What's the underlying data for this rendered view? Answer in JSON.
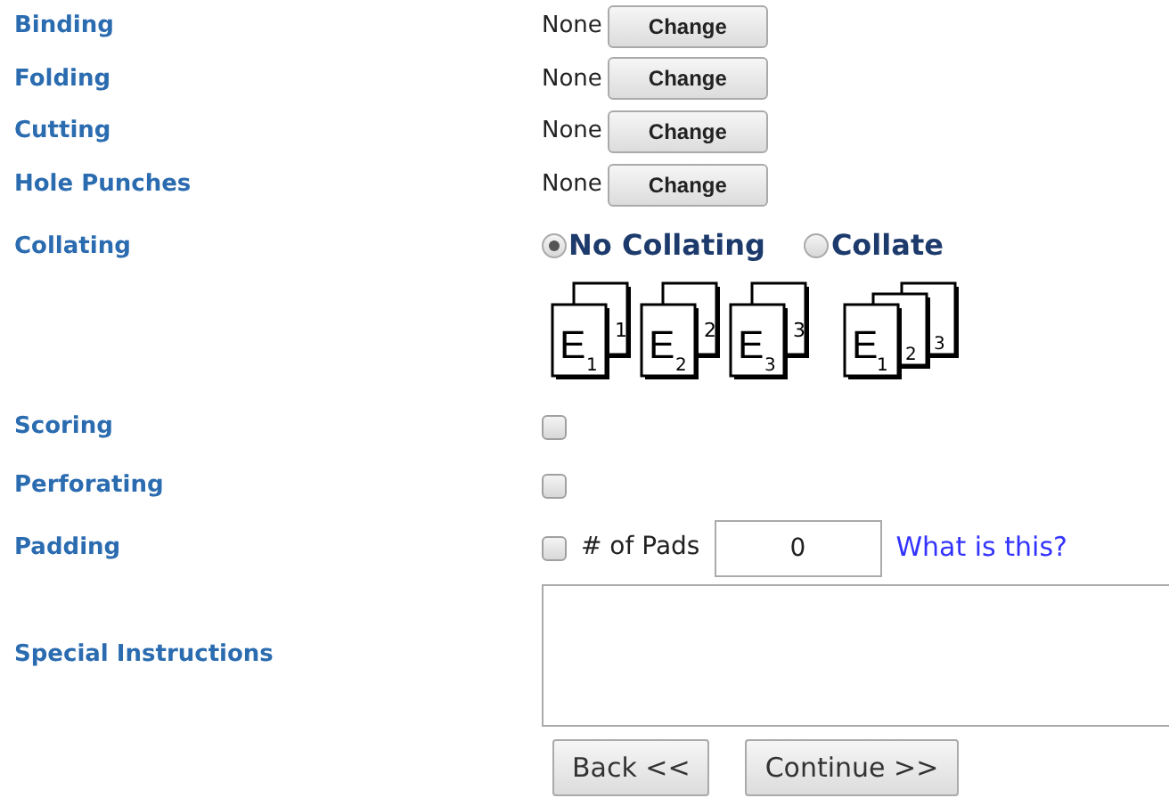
{
  "options": [
    {
      "label": "Binding",
      "value": "None",
      "button": "Change"
    },
    {
      "label": "Folding",
      "value": "None",
      "button": "Change"
    },
    {
      "label": "Cutting",
      "value": "None",
      "button": "Change"
    },
    {
      "label": "Hole Punches",
      "value": "None",
      "button": "Change"
    }
  ],
  "collating": {
    "label": "Collating",
    "choices": [
      {
        "label": "No Collating",
        "selected": true,
        "kind": "separate",
        "stacks": [
          {
            "letter": "E",
            "front_number": "1",
            "back_number": "1"
          },
          {
            "letter": "E",
            "front_number": "2",
            "back_number": "2"
          },
          {
            "letter": "E",
            "front_number": "3",
            "back_number": "3"
          }
        ]
      },
      {
        "label": "Collate",
        "selected": false,
        "kind": "collated",
        "pages": [
          {
            "letter": "E",
            "number": "1"
          },
          {
            "number": "2"
          },
          {
            "number": "3"
          }
        ]
      }
    ]
  },
  "checks": [
    {
      "label": "Scoring",
      "checked": false
    },
    {
      "label": "Perforating",
      "checked": false
    }
  ],
  "padding": {
    "label": "Padding",
    "checked": false,
    "pads_label": "# of Pads",
    "pads_value": "0",
    "help_link": "What is this?"
  },
  "special_instructions": {
    "label": "Special Instructions"
  },
  "buttons": [
    "Back <<",
    "Continue >>"
  ]
}
